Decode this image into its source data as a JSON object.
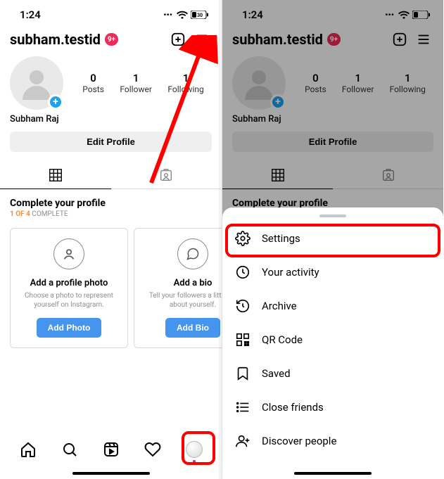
{
  "status": {
    "time": "1:24",
    "battery_pct": "30"
  },
  "header": {
    "username": "subham.testid",
    "notification": "9+"
  },
  "profile": {
    "display_name": "Subham Raj",
    "stats": {
      "posts": {
        "count": "0",
        "label": "Posts"
      },
      "followers": {
        "count": "1",
        "label": "Follower"
      },
      "following": {
        "count": "1",
        "label": "Following"
      }
    },
    "edit_button": "Edit Profile"
  },
  "complete": {
    "title": "Complete your profile",
    "progress_prefix": "1 OF 4",
    "progress_suffix": " COMPLETE",
    "cards": [
      {
        "title": "Add a profile photo",
        "desc": "Choose a photo to represent yourself on Instagram.",
        "button": "Add Photo"
      },
      {
        "title": "Add a bio",
        "desc": "Tell your followers a little bit about yourself.",
        "button": "Add Bio"
      }
    ]
  },
  "menu": {
    "items": [
      {
        "label": "Settings",
        "icon": "settings"
      },
      {
        "label": "Your activity",
        "icon": "activity"
      },
      {
        "label": "Archive",
        "icon": "archive"
      },
      {
        "label": "QR Code",
        "icon": "qr"
      },
      {
        "label": "Saved",
        "icon": "bookmark"
      },
      {
        "label": "Close friends",
        "icon": "list"
      },
      {
        "label": "Discover people",
        "icon": "person-add"
      }
    ]
  }
}
